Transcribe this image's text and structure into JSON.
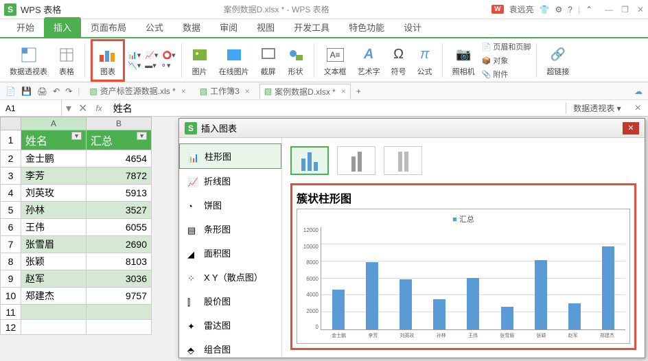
{
  "title_bar": {
    "app_icon": "S",
    "app_name": "WPS 表格",
    "doc_title": "案例数据D.xlsx * - WPS 表格",
    "wps_badge": "W",
    "user_name": "袁远亮",
    "win_min": "—",
    "win_restore": "❐",
    "win_close": "✕"
  },
  "tabs": {
    "start": "开始",
    "insert": "插入",
    "page_layout": "页面布局",
    "formula": "公式",
    "data": "数据",
    "review": "审阅",
    "view": "视图",
    "dev": "开发工具",
    "special": "特色功能",
    "design": "设计"
  },
  "ribbon": {
    "pivot": "数据透视表",
    "table": "表格",
    "chart": "图表",
    "picture": "图片",
    "online_pic": "在线图片",
    "screenshot": "截屏",
    "shapes": "形状",
    "textbox": "文本框",
    "wordart": "艺术字",
    "symbol": "符号",
    "equation": "公式",
    "camera": "照相机",
    "header_footer": "页眉和页脚",
    "object": "对象",
    "attachment": "附件",
    "hyperlink": "超链接"
  },
  "file_tabs": {
    "tab1": "资产标签源数据.xls *",
    "tab2": "工作簿3",
    "tab3": "案例数据D.xlsx *",
    "add": "+"
  },
  "formula_bar": {
    "name_box": "A1",
    "fx": "fx",
    "value": "姓名",
    "pivot": "数据透视表 ▾"
  },
  "sheet": {
    "col_a": "A",
    "col_b": "B",
    "header_name": "姓名",
    "header_total": "汇总",
    "rows": [
      {
        "n": "1"
      },
      {
        "n": "2",
        "name": "金士鹏",
        "val": "4654"
      },
      {
        "n": "3",
        "name": "李芳",
        "val": "7872"
      },
      {
        "n": "4",
        "name": "刘英玫",
        "val": "5913"
      },
      {
        "n": "5",
        "name": "孙林",
        "val": "3527"
      },
      {
        "n": "6",
        "name": "王伟",
        "val": "6055"
      },
      {
        "n": "7",
        "name": "张雪眉",
        "val": "2690"
      },
      {
        "n": "8",
        "name": "张颖",
        "val": "8103"
      },
      {
        "n": "9",
        "name": "赵军",
        "val": "3036"
      },
      {
        "n": "10",
        "name": "郑建杰",
        "val": "9757"
      },
      {
        "n": "11"
      },
      {
        "n": "12"
      }
    ]
  },
  "dialog": {
    "title": "插入图表",
    "types": {
      "column": "柱形图",
      "line": "折线图",
      "pie": "饼图",
      "bar": "条形图",
      "area": "面积图",
      "scatter": "X Y（散点图）",
      "stock": "股价图",
      "radar": "雷达图",
      "combo": "组合图"
    },
    "preview_title": "簇状柱形图",
    "legend": "汇总"
  },
  "chart_data": {
    "type": "bar",
    "title": "簇状柱形图",
    "legend": "汇总",
    "categories": [
      "金士鹏",
      "李芳",
      "刘英玫",
      "孙林",
      "王伟",
      "张雪眉",
      "张颖",
      "赵军",
      "郑建杰"
    ],
    "values": [
      4654,
      7872,
      5913,
      3527,
      6055,
      2690,
      8103,
      3036,
      9757
    ],
    "ylim": [
      0,
      12000
    ],
    "y_ticks": [
      "12000",
      "10000",
      "8000",
      "6000",
      "4000",
      "2000",
      "0"
    ]
  }
}
